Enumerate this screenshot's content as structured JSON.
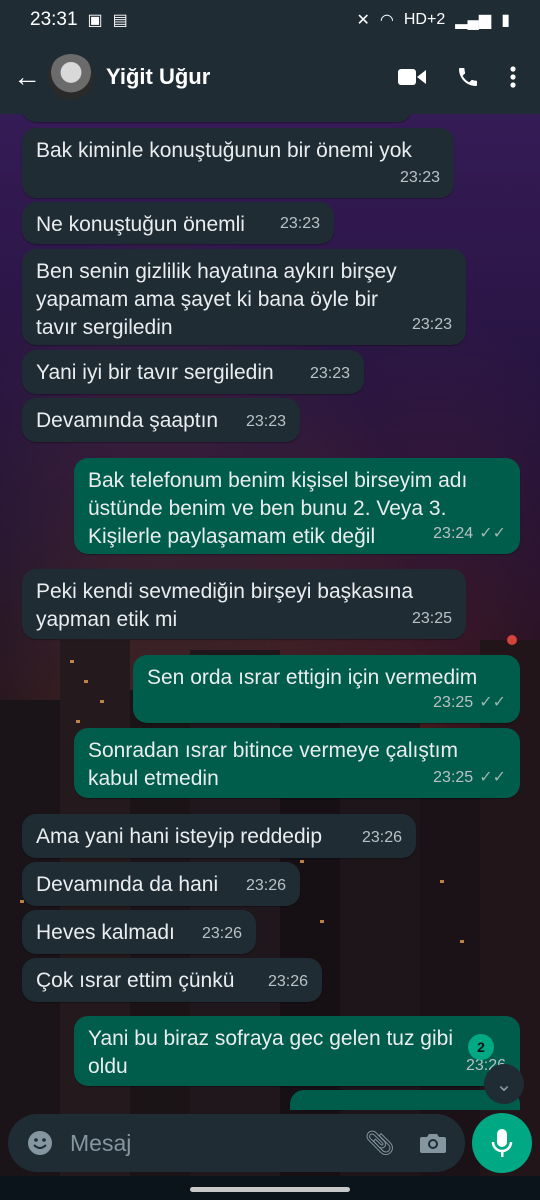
{
  "status_bar": {
    "time": "23:31",
    "network": "HD+2"
  },
  "header": {
    "contact_name": "Yiğit Uğur"
  },
  "messages": [
    {
      "direction": "in",
      "text": "Bak kiminle konuştuğunun bir önemi yok",
      "time": "23:23"
    },
    {
      "direction": "in",
      "text": "Ne konuştuğun önemli",
      "time": "23:23"
    },
    {
      "direction": "in",
      "text": "Ben senin gizlilik hayatına aykırı birşey yapamam ama şayet ki bana öyle bir tavır sergiledin",
      "time": "23:23"
    },
    {
      "direction": "in",
      "text": "Yani iyi bir tavır sergiledin",
      "time": "23:23"
    },
    {
      "direction": "in",
      "text": "Devamında şaaptın",
      "time": "23:23"
    },
    {
      "direction": "out",
      "text": "Bak telefonum benim kişisel birseyim adı üstünde benim ve ben bunu 2. Veya 3. Kişilerle paylaşamam etik değil",
      "time": "23:24"
    },
    {
      "direction": "in",
      "text": "Peki kendi sevmediğin birşeyi başkasına yapman etik mi",
      "time": "23:25"
    },
    {
      "direction": "out",
      "text": "Sen orda ısrar ettigin için vermedim",
      "time": "23:25"
    },
    {
      "direction": "out",
      "text": "Sonradan ısrar bitince vermeye çalıştım kabul etmedin",
      "time": "23:25"
    },
    {
      "direction": "in",
      "text": "Ama yani hani isteyip reddedip",
      "time": "23:26"
    },
    {
      "direction": "in",
      "text": "Devamında da hani",
      "time": "23:26"
    },
    {
      "direction": "in",
      "text": "Heves kalmadı",
      "time": "23:26"
    },
    {
      "direction": "in",
      "text": "Çok ısrar ettim çünkü",
      "time": "23:26"
    },
    {
      "direction": "out",
      "text": "Yani bu biraz sofraya gec gelen tuz gibi oldu",
      "time": "23:26"
    }
  ],
  "unread_count": "2",
  "composer": {
    "placeholder": "Mesaj"
  },
  "colors": {
    "header_bg": "#1f2c34",
    "incoming_bubble": "#1f2c34",
    "outgoing_bubble": "#005c4b",
    "accent": "#00a884"
  }
}
